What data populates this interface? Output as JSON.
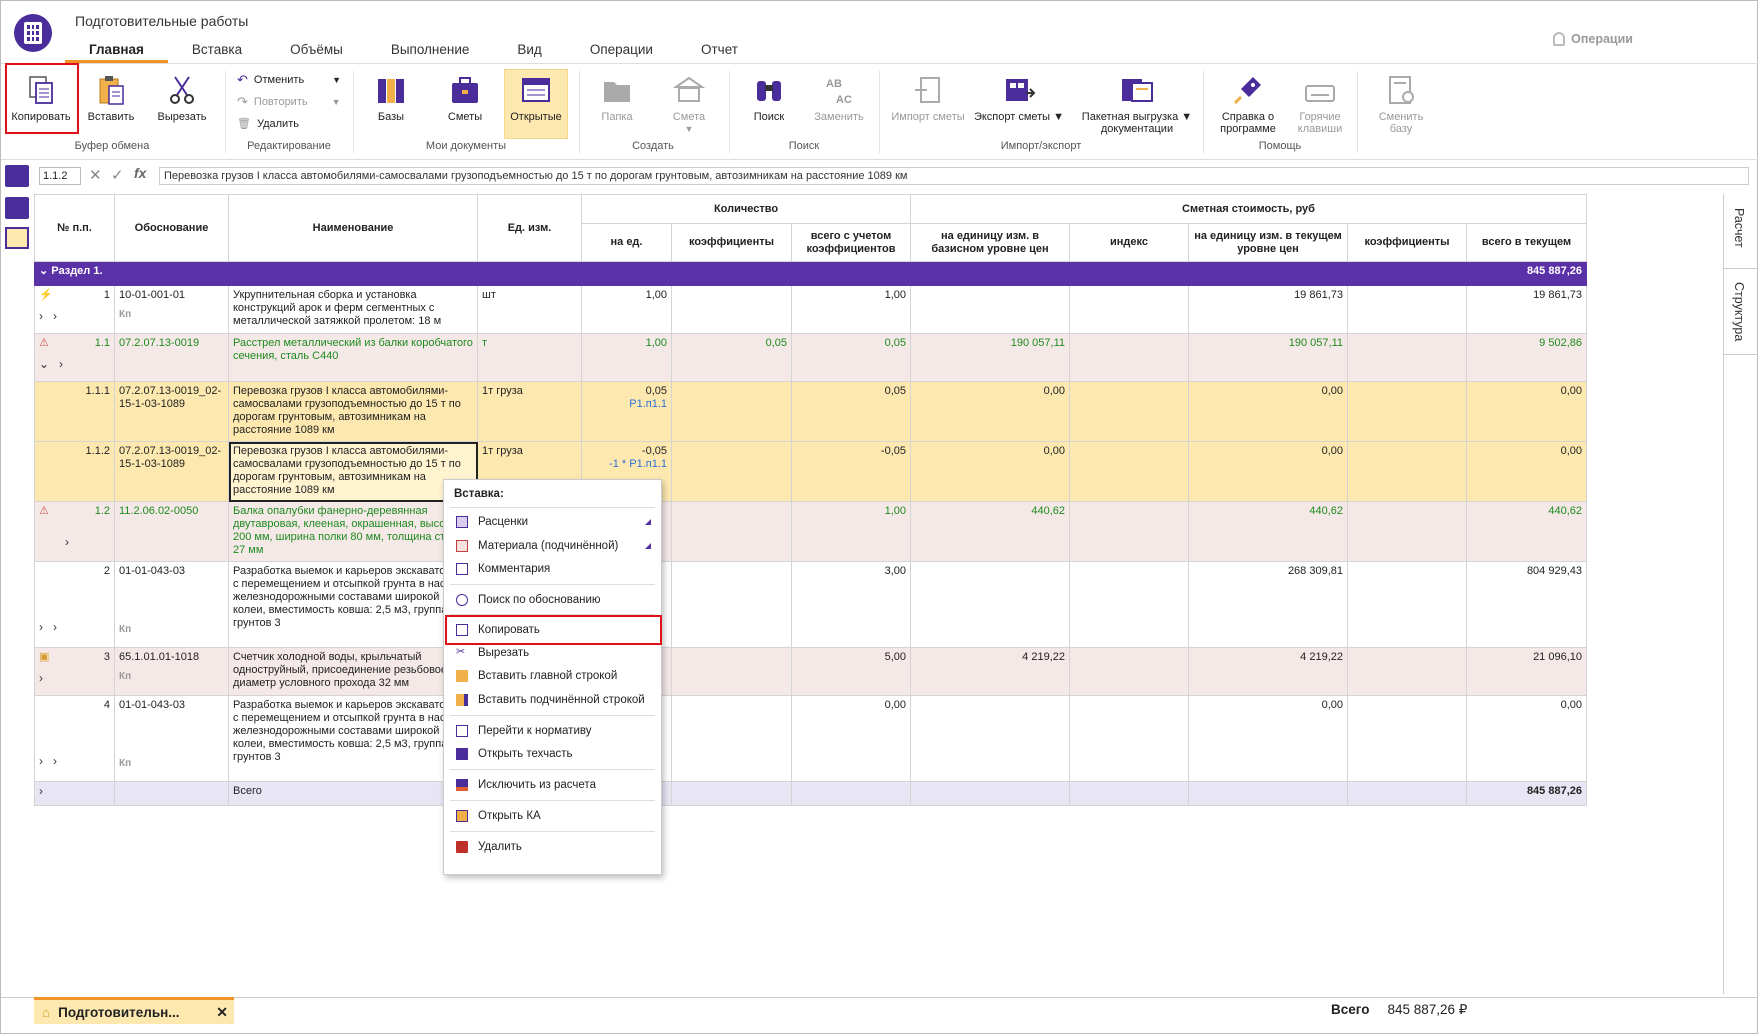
{
  "window": {
    "title": "Подготовительные работы"
  },
  "tabs": [
    {
      "label": "Главная"
    },
    {
      "label": "Вставка"
    },
    {
      "label": "Объёмы"
    },
    {
      "label": "Выполнение"
    },
    {
      "label": "Вид"
    },
    {
      "label": "Операции"
    },
    {
      "label": "Отчет"
    }
  ],
  "operations_label": "Операции",
  "ribbon": {
    "copy": "Копировать",
    "paste": "Вставить",
    "cut": "Вырезать",
    "clipboard_group": "Буфер обмена",
    "undo": "Отменить",
    "redo": "Повторить",
    "delete": "Удалить",
    "edit_group": "Редактирование",
    "bases": "Базы",
    "estimates": "Сметы",
    "open": "Открытые",
    "docs_group": "Мои документы",
    "folder": "Папка",
    "estimate": "Смета",
    "create_group": "Создать",
    "search": "Поиск",
    "replace": "Заменить",
    "search_group": "Поиск",
    "import": "Импорт сметы",
    "export": "Экспорт сметы",
    "batch1": "Пакетная выгрузка",
    "batch2": "документации",
    "io_group": "Импорт/экспорт",
    "help1": "Справка о",
    "help2": "программе",
    "hot1": "Горячие",
    "hot2": "клавиши",
    "help_group": "Помощь",
    "changebase1": "Сменить",
    "changebase2": "базу"
  },
  "formula": {
    "cell": "1.1.2",
    "text": "Перевозка грузов I класса автомобилями-самосвалами грузоподъемностью до 15 т по дорогам грунтовым, автозимникам на расстояние 1089 км"
  },
  "headers": {
    "num": "№ п.п.",
    "basis": "Обоснование",
    "name": "Наименование",
    "unit": "Ед. изм.",
    "qty": "Количество",
    "cost": "Сметная стоимость, руб",
    "per_unit": "на ед.",
    "coef": "коэффициенты",
    "total_coef": "всего с учетом коэффициентов",
    "base_price": "на единицу изм. в базисном уровне цен",
    "index": "индекс",
    "cur_price": "на единицу изм. в текущем уровне цен",
    "coef2": "коэффициенты",
    "total_cur": "всего в текущем"
  },
  "section": {
    "label": "Раздел 1.",
    "total": "845 887,26"
  },
  "rows": [
    {
      "num": "1",
      "basis": "10-01-001-01",
      "name": "Укрупнительная сборка и установка конструкций арок и ферм сегментных с металлической затяжкой пролетом: 18 м",
      "unit": "шт",
      "per_unit": "1,00",
      "coef": "",
      "total": "1,00",
      "base": "",
      "index": "",
      "cur": "19 861,73",
      "coef2": "",
      "sum": "19 861,73"
    },
    {
      "num": "1.1",
      "basis": "07.2.07.13-0019",
      "name": "Расстрел металлический из балки коробчатого сечения, сталь С440",
      "unit": "т",
      "per_unit": "1,00",
      "coef": "0,05",
      "total": "0,05",
      "base": "190 057,11",
      "index": "",
      "cur": "190 057,11",
      "coef2": "",
      "sum": "9 502,86"
    },
    {
      "num": "1.1.1",
      "basis": "07.2.07.13-0019_02-15-1-03-1089",
      "name": "Перевозка грузов I класса автомобилями-самосвалами грузоподъемностью до 15 т по дорогам грунтовым, автозимникам на расстояние 1089 км",
      "unit": "1т груза",
      "per_unit": "0,05",
      "per_unit2": "Р1.п1.1",
      "total": "0,05",
      "base": "0,00",
      "cur": "0,00",
      "sum": "0,00"
    },
    {
      "num": "1.1.2",
      "basis": "07.2.07.13-0019_02-15-1-03-1089",
      "name": "Перевозка грузов I класса автомобилями-самосвалами грузоподъемностью до 15 т по дорогам грунтовым, автозимникам на расстояние 1089 км",
      "unit": "1т груза",
      "per_unit": "-0,05",
      "per_unit2": "-1 * Р1.п1.1",
      "total": "-0,05",
      "base": "0,00",
      "cur": "0,00",
      "sum": "0,00"
    },
    {
      "num": "1.2",
      "basis": "11.2.06.02-0050",
      "name": "Балка опалубки фанерно-деревянная двутавровая, клееная, окрашенная, высота 200 мм, ширина полки 80 мм, толщина стенки 27 мм",
      "total": "1,00",
      "base": "440,62",
      "cur": "440,62",
      "sum": "440,62"
    },
    {
      "num": "2",
      "basis": "01-01-043-03",
      "name": "Разработка выемок и карьеров экскаваторами с перемещением и отсыпкой грунта в насыпи железнодорожными составами широкой колеи, вместимость ковша: 2,5 м3, группа грунтов 3",
      "total": "3,00",
      "cur": "268 309,81",
      "sum": "804 929,43"
    },
    {
      "num": "3",
      "basis": "65.1.01.01-1018",
      "name": "Счетчик холодной воды, крыльчатый одноструйный, присоединение резьбовое, диаметр условного прохода 32 мм",
      "total": "5,00",
      "base": "4 219,22",
      "cur": "4 219,22",
      "sum": "21 096,10"
    },
    {
      "num": "4",
      "basis": "01-01-043-03",
      "name": "Разработка выемок и карьеров экскаваторами с перемещением и отсыпкой грунта в насыпи железнодорожными составами широкой колеи, вместимость ковша: 2,5 м3, группа грунтов 3",
      "total": "0,00",
      "cur": "0,00",
      "sum": "0,00"
    }
  ],
  "total_row": {
    "label": "Всего",
    "sum": "845 887,26"
  },
  "kp": "Кп",
  "context_menu": {
    "header": "Вставка:",
    "items": [
      "Расценки",
      "Материала (подчинённой)",
      "Комментария",
      "Поиск по обоснованию",
      "Копировать",
      "Вырезать",
      "Вставить главной строкой",
      "Вставить подчинённой строкой",
      "Перейти к нормативу",
      "Открыть техчасть",
      "Исключить из расчета",
      "Открыть КА",
      "Удалить"
    ]
  },
  "side_tabs": [
    "Расчет",
    "Структура"
  ],
  "doc_tab": "Подготовительн...",
  "footer": {
    "label": "Всего",
    "value": "845 887,26 ₽"
  }
}
